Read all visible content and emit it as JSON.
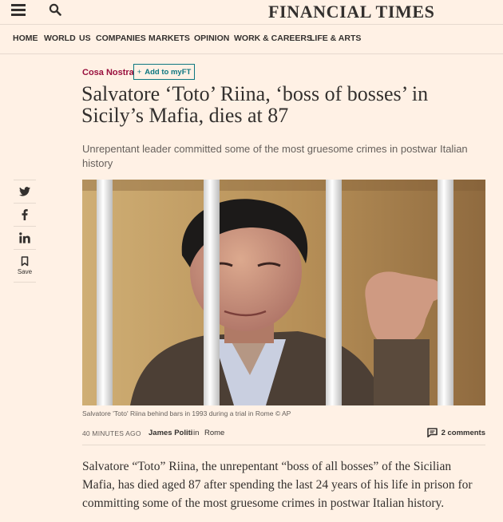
{
  "header": {
    "masthead": "FINANCIAL TIMES",
    "menu_icon": "hamburger-menu-icon",
    "search_icon": "search-icon"
  },
  "nav": {
    "items": [
      "HOME",
      "WORLD",
      "US",
      "COMPANIES",
      "MARKETS",
      "OPINION",
      "WORK & CAREERS",
      "LIFE & ARTS"
    ]
  },
  "article": {
    "topic": "Cosa Nostra",
    "add_myft_label": "Add to myFT",
    "headline": "Salvatore ‘Toto’ Riina, ‘boss of bosses’ in Sicily’s Mafia, dies at 87",
    "standfirst": "Unrepentant leader committed some of the most gruesome crimes in postwar Italian history",
    "image_caption": "Salvatore 'Toto' Riina behind bars in 1993 during a trial in Rome © AP",
    "timestamp": "40 MINUTES AGO",
    "author": "James Politi",
    "in_text": "in",
    "location": "Rome",
    "comments_label": "2 comments",
    "body_first_paragraph": "Salvatore “Toto” Riina, the unrepentant “boss of all bosses” of the Sicilian Mafia, has died aged 87 after spending the last 24 years of his life in prison for committing some of the most gruesome crimes in postwar Italian history."
  },
  "share": {
    "save_label": "Save",
    "icons": [
      "twitter-icon",
      "facebook-icon",
      "linkedin-icon",
      "bookmark-icon"
    ]
  },
  "colors": {
    "page_background": "#fff1e5",
    "topic_claret": "#990f3d",
    "myft_teal": "#0d7680",
    "text": "#33302e",
    "muted_text": "#66605c"
  }
}
